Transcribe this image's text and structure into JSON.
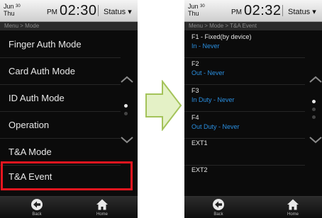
{
  "left": {
    "date_month": "Jun",
    "date_day": "30",
    "date_weekday": "Thu",
    "ampm": "PM",
    "time": "02:30",
    "status": "Status",
    "breadcrumb": "Menu > Mode",
    "items": [
      {
        "label": "Finger Auth Mode"
      },
      {
        "label": "Card Auth Mode"
      },
      {
        "label": "ID Auth Mode"
      },
      {
        "label": "Operation"
      },
      {
        "label": "T&A Mode"
      },
      {
        "label": "T&A Event"
      }
    ],
    "back_label": "Back",
    "home_label": "Home"
  },
  "right": {
    "date_month": "Jun",
    "date_day": "30",
    "date_weekday": "Thu",
    "ampm": "PM",
    "time": "02:32",
    "status": "Status",
    "breadcrumb": "Menu > Mode > T&A Event",
    "events": [
      {
        "name": "F1  - Fixed(by device)",
        "value": "In  - Never"
      },
      {
        "name": "F2",
        "value": "Out - Never"
      },
      {
        "name": "F3",
        "value": "In Duty - Never"
      },
      {
        "name": "F4",
        "value": "Out Duty - Never"
      },
      {
        "name": "EXT1",
        "value": ""
      },
      {
        "name": "EXT2",
        "value": ""
      }
    ],
    "back_label": "Back",
    "home_label": "Home"
  },
  "icons": {
    "chevron_up": "chevron-up-icon",
    "chevron_down": "chevron-down-icon",
    "back": "back-arrow-icon",
    "home": "home-icon",
    "transition_arrow": "right-arrow-icon"
  },
  "colors": {
    "highlight": "#e8151f",
    "event_value": "#2a8fe0",
    "arrow_fill": "#e4f1c6"
  }
}
